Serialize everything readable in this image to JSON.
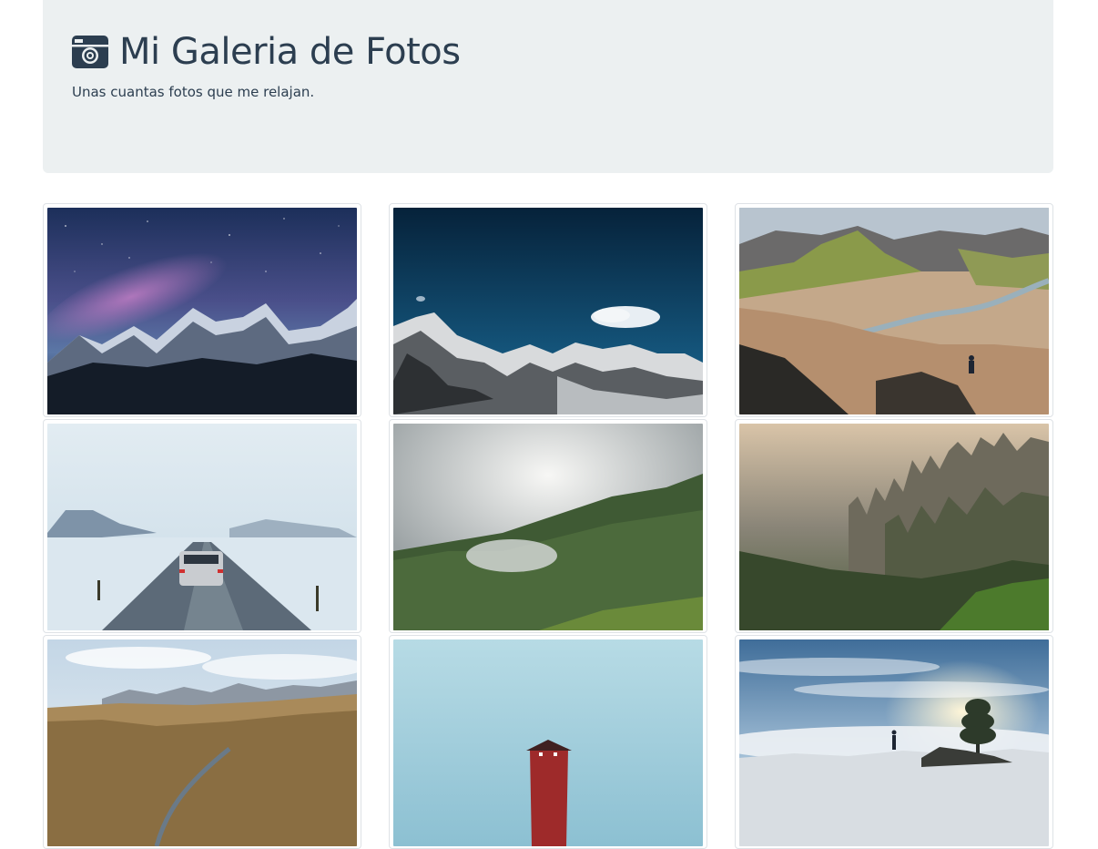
{
  "header": {
    "title": "Mi Galeria de Fotos",
    "subtitle": "Unas cuantas fotos que me relajan.",
    "icon": "camera-icon"
  },
  "gallery": {
    "photos": [
      {
        "name": "photo-milky-way-mountains"
      },
      {
        "name": "photo-snowy-peaks-blue-sky"
      },
      {
        "name": "photo-river-valley-hiker"
      },
      {
        "name": "photo-car-snowy-road"
      },
      {
        "name": "photo-foggy-green-hills"
      },
      {
        "name": "photo-misty-rock-pillars"
      },
      {
        "name": "photo-dry-grassland-stream"
      },
      {
        "name": "photo-red-cabin-blue-sky"
      },
      {
        "name": "photo-sunrise-tree-clouds"
      }
    ]
  },
  "colors": {
    "jumbotron_bg": "#ecf0f1",
    "text": "#2c3e50"
  }
}
